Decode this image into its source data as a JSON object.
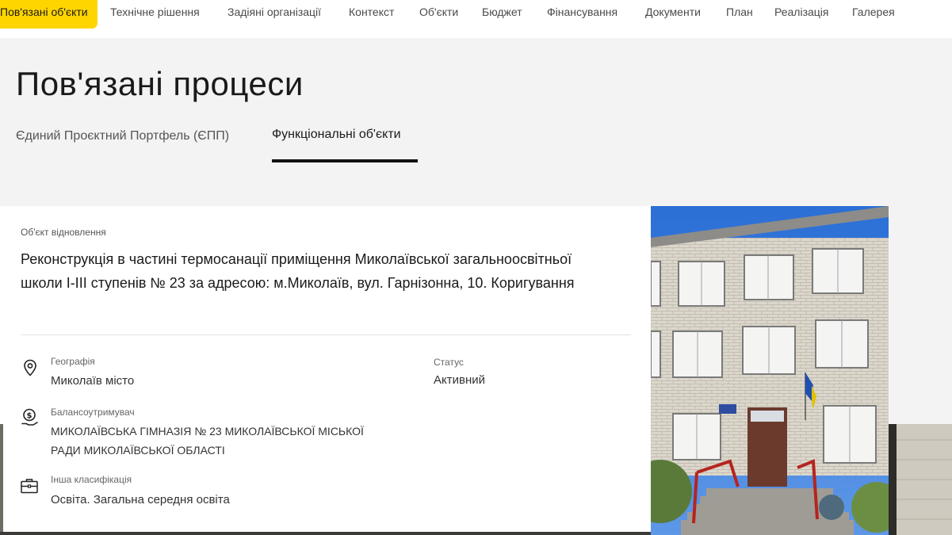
{
  "nav": {
    "items": [
      "Пов'язані об'єкти",
      "Технічне рішення",
      "Задіяні організації",
      "Контекст",
      "Об'єкти",
      "Бюджет",
      "Фінансування",
      "Документи",
      "План",
      "Реалізація",
      "Галерея"
    ],
    "active_index": 0,
    "accent_color": "#ffd500"
  },
  "page": {
    "title": "Пов'язані процеси",
    "tabs": [
      "Єдиний Проєктний Портфель (ЄПП)",
      "Функціональні об'єкти"
    ],
    "active_tab": 1
  },
  "card": {
    "label": "Об'єкт відновлення",
    "title": "Реконструкція в частині термосанації приміщення Миколаївської загальноосвітньої школи I-III ступенів № 23 за адресою: м.Миколаїв, вул. Гарнізонна, 10. Коригування",
    "geography": {
      "icon": "location-pin-icon",
      "label": "Географія",
      "value": "Миколаїв місто"
    },
    "status": {
      "label": "Статус",
      "value": "Активний"
    },
    "balance_holder": {
      "icon": "money-bag-icon",
      "label": "Балансоутримувач",
      "value": "МИКОЛАЇВСЬКА ГІМНАЗІЯ № 23 МИКОЛАЇВСЬКОЇ МІСЬКОЇ РАДИ МИКОЛАЇВСЬКОЇ ОБЛАСТІ"
    },
    "classification": {
      "icon": "briefcase-icon",
      "label": "Інша класифікація",
      "value": "Освіта. Загальна середня освіта"
    }
  },
  "photo": {
    "icon": "school-building-photo"
  }
}
